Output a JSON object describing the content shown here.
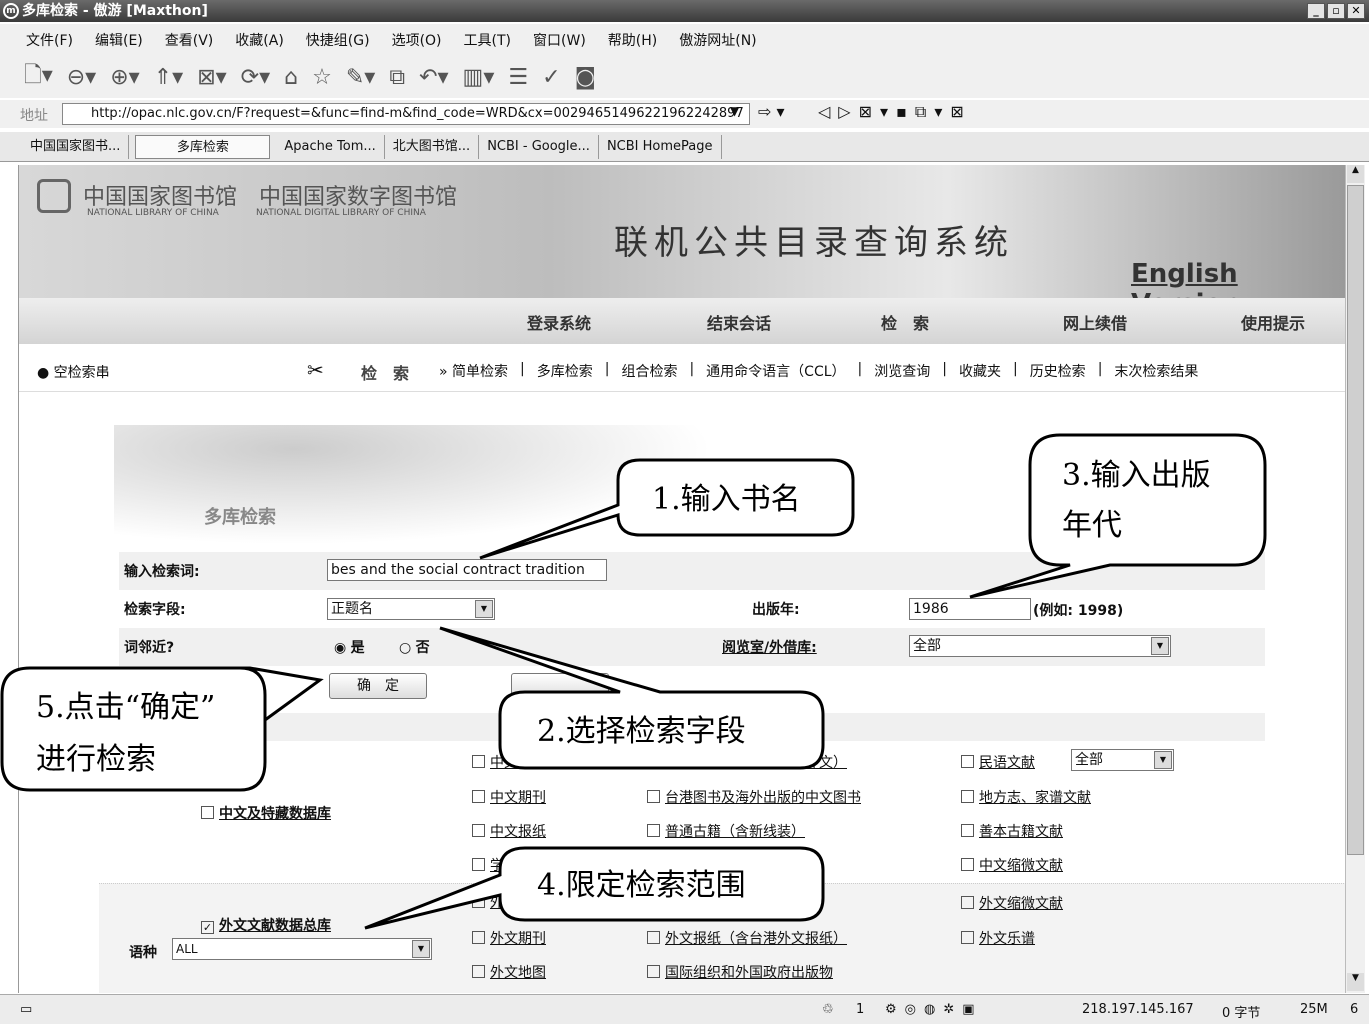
{
  "window": {
    "title": "多库检索 - 傲游 [Maxthon]"
  },
  "menu": [
    "文件(F)",
    "编辑(E)",
    "查看(V)",
    "收藏(A)",
    "快捷组(G)",
    "选项(O)",
    "工具(T)",
    "窗口(W)",
    "帮助(H)",
    "傲游网址(N)"
  ],
  "address": {
    "label": "地址",
    "url": "http://opac.nlc.gov.cn/F?request=&func=find-m&find_code=WRD&cx=00294651496221962242897"
  },
  "tabs": [
    "中国国家图书...",
    "多库检索",
    "Apache Tom...",
    "北大图书馆...",
    "NCBI - Google...",
    "NCBI HomePage"
  ],
  "banner": {
    "lib_cn": "中国国家图书馆",
    "lib_en": "NATIONAL LIBRARY OF CHINA",
    "dlib_cn": "中国国家数字图书馆",
    "dlib_en": "NATIONAL DIGITAL LIBRARY OF CHINA",
    "system": "联机公共目录查询系统",
    "english": "English Version"
  },
  "nav": [
    "登录系统",
    "结束会话",
    "检　索",
    "网上续借",
    "使用提示"
  ],
  "subnav": {
    "clear": "空检索串",
    "search": "检　索",
    "links": [
      "» 简单检索",
      "多库检索",
      "组合检索",
      "通用命令语言（CCL）",
      "浏览查询",
      "收藏夹",
      "历史检索",
      "末次检索结果"
    ]
  },
  "form": {
    "heading": "多库检索",
    "query_label": "输入检索词:",
    "query_value": "bes and the social contract tradition",
    "field_label": "检索字段:",
    "field_value": "正题名",
    "year_label": "出版年:",
    "year_value": "1986",
    "year_hint": "(例如: 1998)",
    "near_label": "词邻近?",
    "yes": "是",
    "no": "否",
    "room_label": "阅览室/外借库:",
    "room_value": "全部",
    "ok": "确　定"
  },
  "cn_db": {
    "label": "中文及特藏数据库",
    "col1": [
      "中文图书",
      "中文期刊",
      "中文报纸",
      "学位论文"
    ],
    "col2": [
      "中文普通图书库（含中外文）",
      "台港图书及海外出版的中文图书",
      "普通古籍（含新线装）"
    ],
    "col3": [
      "民语文献",
      "地方志、家谱文献",
      "善本古籍文献",
      "中文缩微文献"
    ],
    "minyu_value": "全部"
  },
  "fr_db": {
    "label": "外文文献数据总库",
    "lang_label": "语种",
    "lang_value": "ALL",
    "col1": [
      "外文图书",
      "外文期刊",
      "外文地图"
    ],
    "col2": [
      "外文报纸（含台港外文报纸）",
      "国际组织和外国政府出版物"
    ],
    "col3": [
      "外文缩微文献",
      "外文乐谱"
    ]
  },
  "callouts": {
    "c1": "1.输入书名",
    "c2": "2.选择检索字段",
    "c3a": "3.输入出版",
    "c3b": "年代",
    "c4": "4.限定检索范围",
    "c5a": "5.点击“确定”",
    "c5b": "进行检索"
  },
  "status": {
    "count": "1",
    "ip": "218.197.145.167",
    "bytes": "0 字节",
    "mem": "25M",
    "num": "6"
  }
}
